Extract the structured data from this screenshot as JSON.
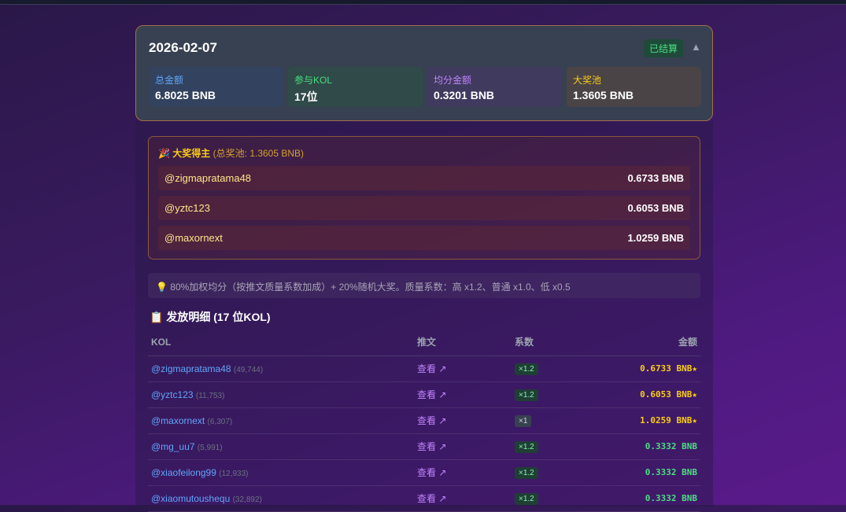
{
  "header": {
    "date": "2026-02-07",
    "status": "已结算",
    "toggle": "▲"
  },
  "stats": [
    {
      "label": "总金额",
      "value": "6.8025 BNB",
      "color": "#60a5fa",
      "bg": "#33425e"
    },
    {
      "label": "参与KOL",
      "value": "17位",
      "color": "#4ade80",
      "bg": "#2f4a48"
    },
    {
      "label": "均分金额",
      "value": "0.3201 BNB",
      "color": "#c084fc",
      "bg": "#3f3a5e"
    },
    {
      "label": "大奖池",
      "value": "1.3605 BNB",
      "color": "#facc15",
      "bg": "#4a4447"
    }
  ],
  "jackpot": {
    "icon": "🎉",
    "title": "大奖得主",
    "subtitle": "(总奖池: 1.3605 BNB)",
    "winners": [
      {
        "name": "@zigmapratama48",
        "amount": "0.6733 BNB"
      },
      {
        "name": "@yztc123",
        "amount": "0.6053 BNB"
      },
      {
        "name": "@maxornext",
        "amount": "1.0259 BNB"
      }
    ]
  },
  "note": "💡 80%加权均分（按推文质量系数加成）+ 20%随机大奖。质量系数：高 x1.2、普通 x1.0、低 x0.5",
  "section_title": "📋 发放明细 (17 位KOL)",
  "table": {
    "headers": [
      "KOL",
      "推文",
      "系数",
      "金额"
    ],
    "rows": [
      {
        "kol": "@zigmapratama48",
        "count": "(49,744)",
        "link": "查看 ↗",
        "coef": "×1.2",
        "amount": "0.6733 BNB",
        "star": "★",
        "winner": true
      },
      {
        "kol": "@yztc123",
        "count": "(11,753)",
        "link": "查看 ↗",
        "coef": "×1.2",
        "amount": "0.6053 BNB",
        "star": "★",
        "winner": true
      },
      {
        "kol": "@maxornext",
        "count": "(6,307)",
        "link": "查看 ↗",
        "coef": "×1",
        "amount": "1.0259 BNB",
        "star": "★",
        "winner": true
      },
      {
        "kol": "@mg_uu7",
        "count": "(5,991)",
        "link": "查看 ↗",
        "coef": "×1.2",
        "amount": "0.3332 BNB",
        "star": "",
        "winner": false
      },
      {
        "kol": "@xiaofeilong99",
        "count": "(12,933)",
        "link": "查看 ↗",
        "coef": "×1.2",
        "amount": "0.3332 BNB",
        "star": "",
        "winner": false
      },
      {
        "kol": "@xiaomutoushequ",
        "count": "(32,892)",
        "link": "查看 ↗",
        "coef": "×1.2",
        "amount": "0.3332 BNB",
        "star": "",
        "winner": false
      }
    ]
  }
}
